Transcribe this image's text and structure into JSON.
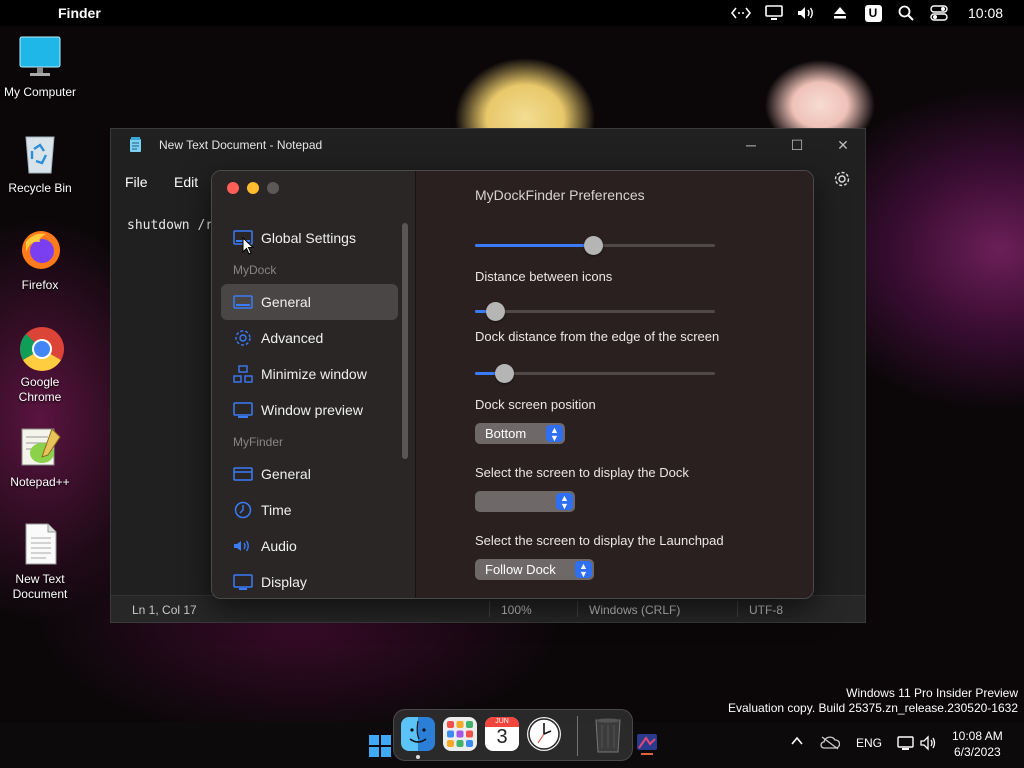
{
  "menubar": {
    "app_name": "Finder",
    "clock": "10:08",
    "icons": [
      "apple-icon",
      "code-arrows-icon",
      "monitor-icon",
      "volume-icon",
      "eject-icon",
      "u-badge-icon",
      "search-icon",
      "control-center-icon"
    ],
    "u_badge": "U"
  },
  "desktop": {
    "icons": [
      {
        "label": "My Computer"
      },
      {
        "label": "Recycle Bin"
      },
      {
        "label": "Firefox"
      },
      {
        "label": "Google Chrome"
      },
      {
        "label": "Notepad++"
      },
      {
        "label": "New Text Document"
      }
    ]
  },
  "notepad": {
    "title": "New Text Document - Notepad",
    "menu": [
      "File",
      "Edit"
    ],
    "text": "shutdown /r",
    "status": {
      "position": "Ln 1, Col 17",
      "zoom": "100%",
      "line_ending": "Windows (CRLF)",
      "encoding": "UTF-8"
    }
  },
  "prefs": {
    "title": "MyDockFinder Preferences",
    "sidebar": {
      "global_settings": "Global Settings",
      "section_mydock": "MyDock",
      "mydock_items": [
        "General",
        "Advanced",
        "Minimize window",
        "Window preview"
      ],
      "section_myfinder": "MyFinder",
      "myfinder_items": [
        "General",
        "Time",
        "Audio",
        "Display"
      ],
      "active": "General"
    },
    "settings": {
      "icon_size_slider": 0.45,
      "distance_between_icons_label": "Distance between icons",
      "distance_between_icons_value": 0.04,
      "dock_distance_label": "Dock distance from the edge of the screen",
      "dock_distance_value": 0.08,
      "dock_position_label": "Dock screen position",
      "dock_position_value": "Bottom",
      "dock_screen_label": "Select the screen to display the Dock",
      "dock_screen_value": "",
      "launchpad_screen_label": "Select the screen to display the Launchpad",
      "launchpad_screen_value": "Follow Dock"
    },
    "accent": "#2f6ff3"
  },
  "watermark": {
    "line1": "Windows 11 Pro Insider Preview",
    "line2": "Evaluation copy. Build 25375.zn_release.230520-1632"
  },
  "dock": {
    "apps": [
      "Finder",
      "Launchpad",
      "Calendar",
      "Clock",
      "Trash"
    ],
    "calendar_month": "JUN",
    "calendar_day": "3"
  },
  "taskbar": {
    "language": "ENG",
    "time": "10:08 AM",
    "date": "6/3/2023"
  }
}
